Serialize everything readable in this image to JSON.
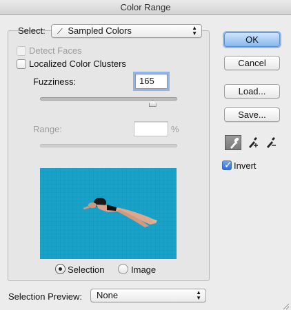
{
  "window": {
    "title": "Color Range"
  },
  "select": {
    "label": "Select:",
    "value": "Sampled Colors"
  },
  "detect_faces": {
    "label": "Detect Faces",
    "checked": false,
    "enabled": false
  },
  "localized_clusters": {
    "label": "Localized Color Clusters",
    "checked": false
  },
  "fuzziness": {
    "label": "Fuzziness:",
    "value": "165",
    "slider_fraction": 0.82
  },
  "range": {
    "label": "Range:",
    "value": "",
    "unit": "%"
  },
  "preview_mode": {
    "selection_label": "Selection",
    "image_label": "Image",
    "selected": "Selection"
  },
  "selection_preview": {
    "label": "Selection Preview:",
    "value": "None"
  },
  "buttons": {
    "ok": "OK",
    "cancel": "Cancel",
    "load": "Load...",
    "save": "Save..."
  },
  "tools": [
    "eyedropper-icon",
    "eyedropper-plus-icon",
    "eyedropper-minus-icon"
  ],
  "invert": {
    "label": "Invert",
    "checked": true
  },
  "colors": {
    "accent": "#2f6fd4",
    "preview_water": "#1a9fc5"
  }
}
